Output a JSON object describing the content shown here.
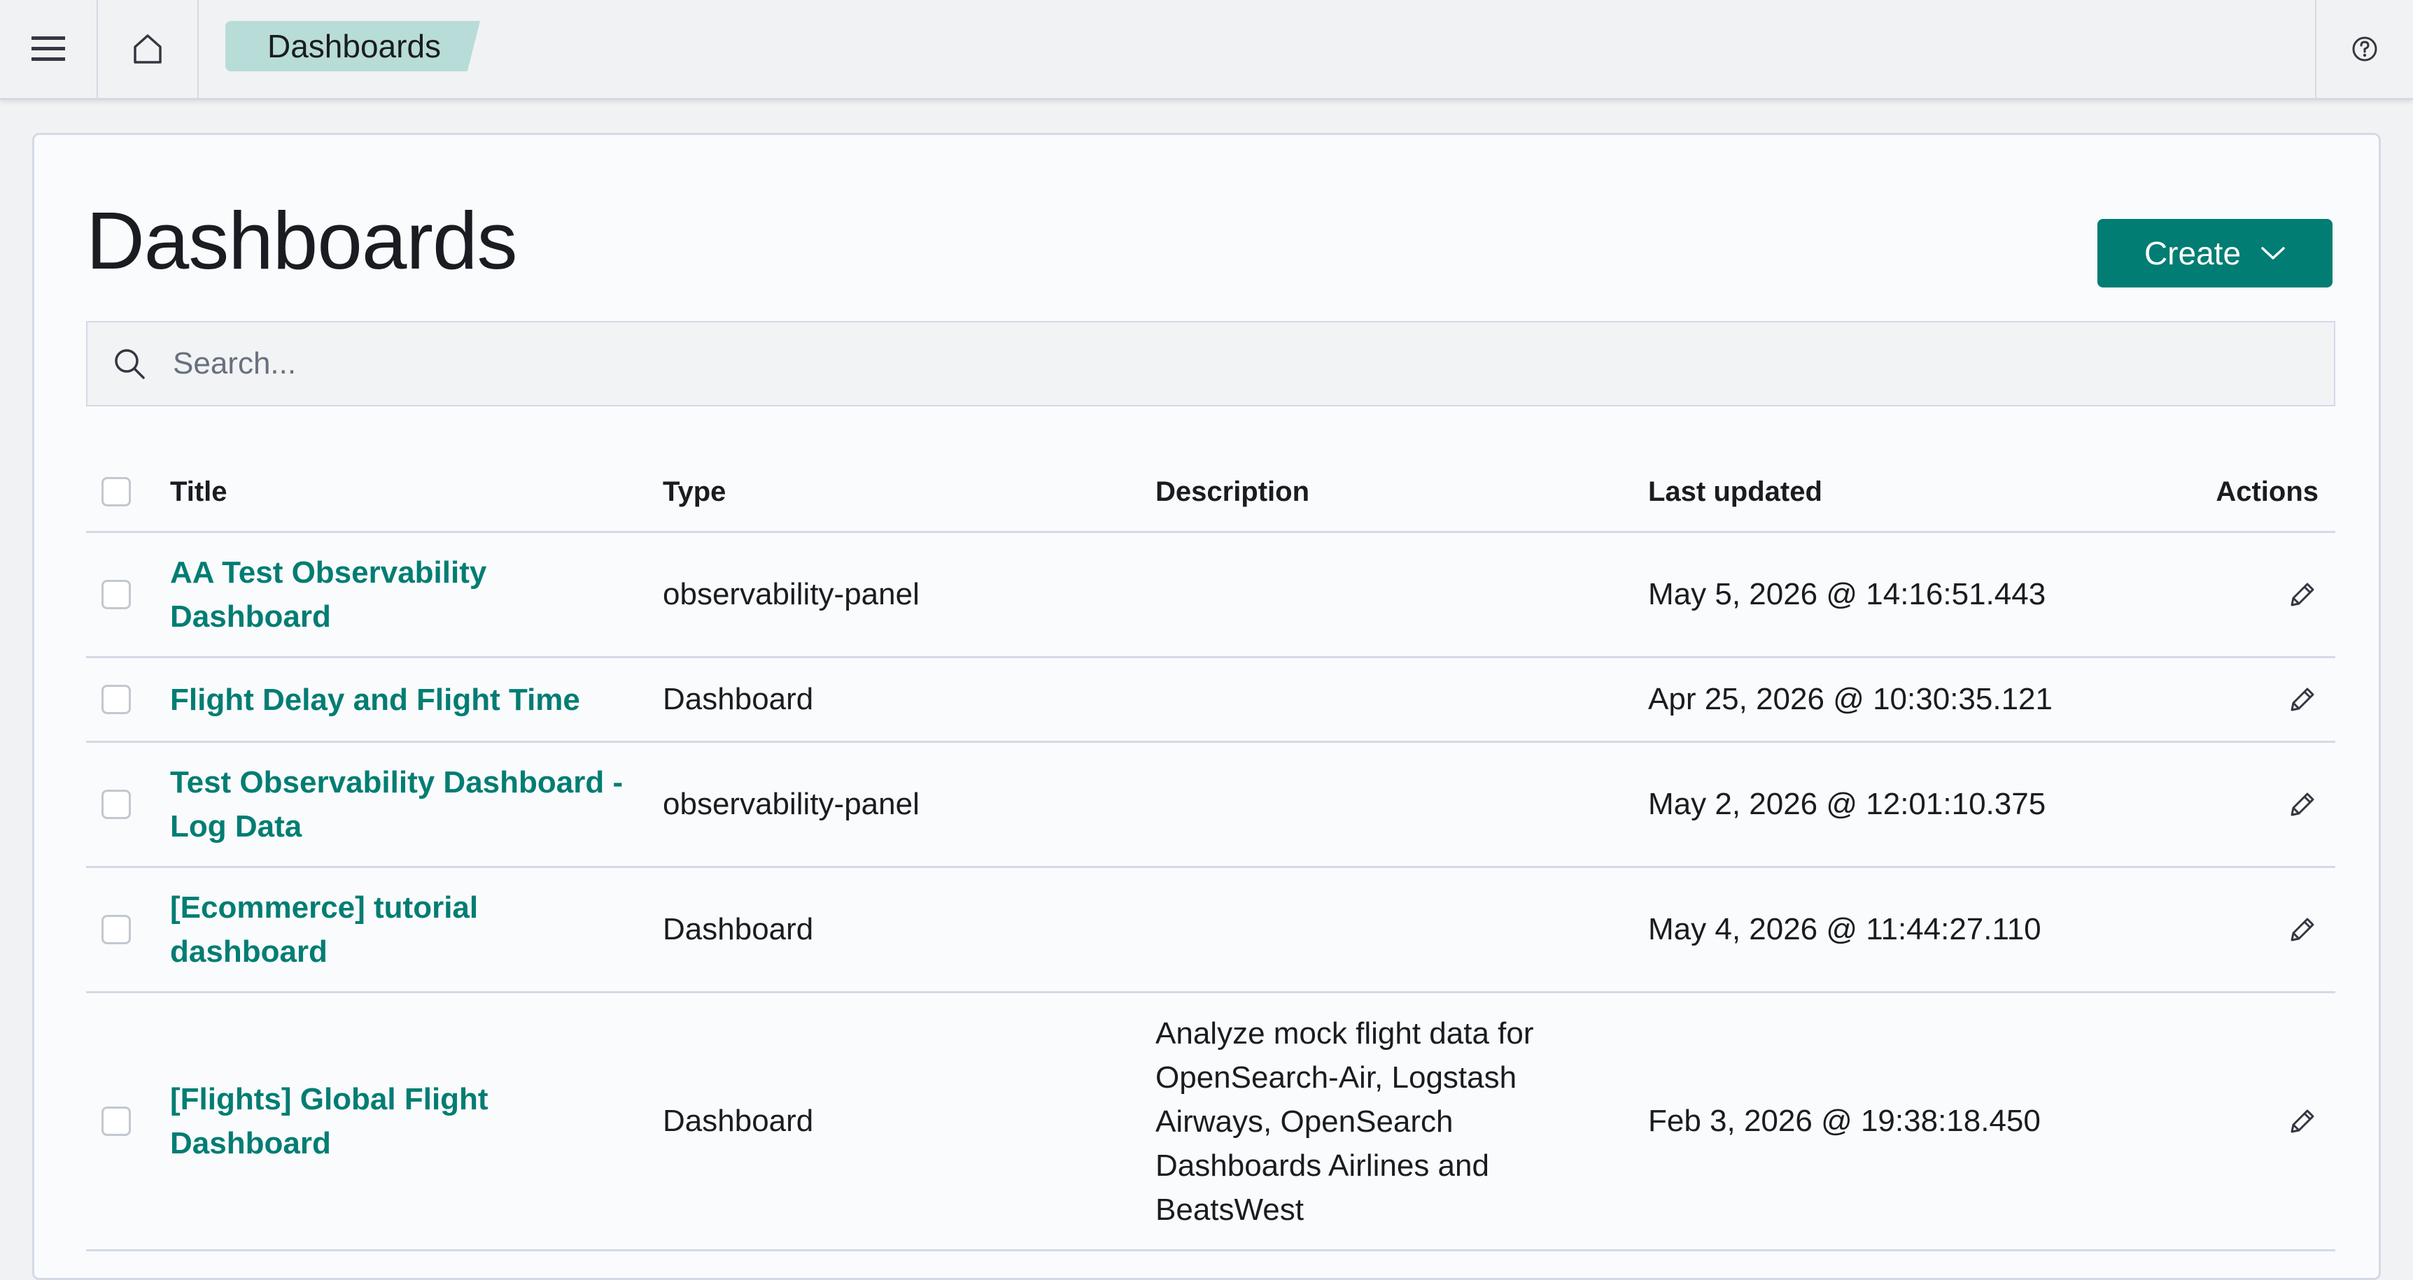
{
  "header": {
    "breadcrumb": "Dashboards",
    "icons": [
      "menu-icon",
      "home-icon",
      "help-icon"
    ]
  },
  "page": {
    "title": "Dashboards",
    "create_label": "Create"
  },
  "search": {
    "placeholder": "Search..."
  },
  "table": {
    "columns": {
      "title": "Title",
      "type": "Type",
      "description": "Description",
      "last_updated": "Last updated",
      "actions": "Actions"
    },
    "rows": [
      {
        "title": "AA Test Observability Dashboard",
        "type": "observability-panel",
        "description": "",
        "last_updated": "May 5, 2026 @ 14:16:51.443"
      },
      {
        "title": "Flight Delay and Flight Time",
        "type": "Dashboard",
        "description": "",
        "last_updated": "Apr 25, 2026 @ 10:30:35.121"
      },
      {
        "title": "Test Observability Dashboard - Log Data",
        "type": "observability-panel",
        "description": "",
        "last_updated": "May 2, 2026 @ 12:01:10.375"
      },
      {
        "title": "[Ecommerce] tutorial dashboard",
        "type": "Dashboard",
        "description": "",
        "last_updated": "May 4, 2026 @ 11:44:27.110"
      },
      {
        "title": "[Flights] Global Flight Dashboard",
        "type": "Dashboard",
        "description": "Analyze mock flight data for OpenSearch-Air, Logstash Airways, OpenSearch Dashboards Airlines and BeatsWest",
        "last_updated": "Feb 3, 2026 @ 19:38:18.450"
      }
    ]
  },
  "colors": {
    "accent": "#017d73",
    "breadcrumb_bg": "#b8dcd8",
    "page_bg": "#f1f2f3",
    "panel_bg": "#fafbfd",
    "border": "#d3dae6"
  }
}
